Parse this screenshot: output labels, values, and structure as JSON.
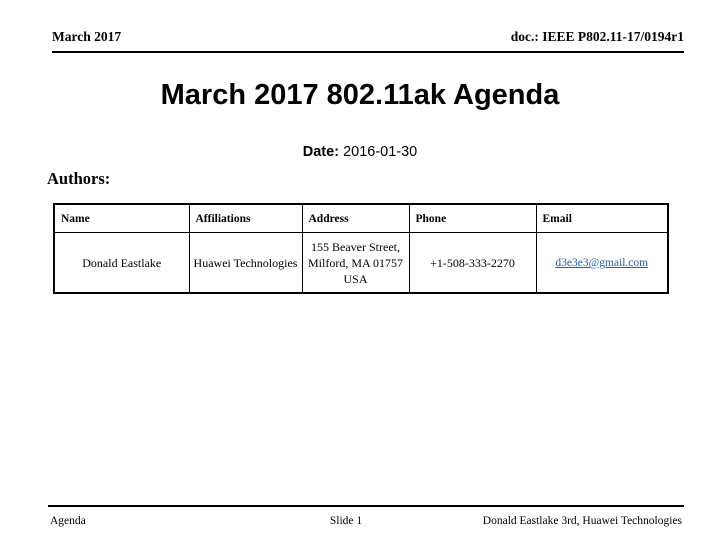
{
  "header": {
    "left": "March 2017",
    "right": "doc.: IEEE P802.11-17/0194r1"
  },
  "title": "March 2017 802.11ak Agenda",
  "date": {
    "label": "Date:",
    "value": "2016-01-30"
  },
  "authors_section": {
    "heading": "Authors:",
    "table": {
      "columns": [
        "Name",
        "Affiliations",
        "Address",
        "Phone",
        "Email"
      ],
      "rows": [
        {
          "name": "Donald Eastlake",
          "affiliations": "Huawei Technologies",
          "address": "155 Beaver Street, Milford, MA 01757 USA",
          "phone": "+1-508-333-2270",
          "email": "d3e3e3@gmail.com"
        }
      ]
    }
  },
  "footer": {
    "left": "Agenda",
    "center": "Slide 1",
    "right": "Donald Eastlake 3rd, Huawei Technologies"
  },
  "colors": {
    "text": "#000000",
    "link": "#2060c0",
    "background": "#ffffff",
    "rule": "#000000"
  }
}
